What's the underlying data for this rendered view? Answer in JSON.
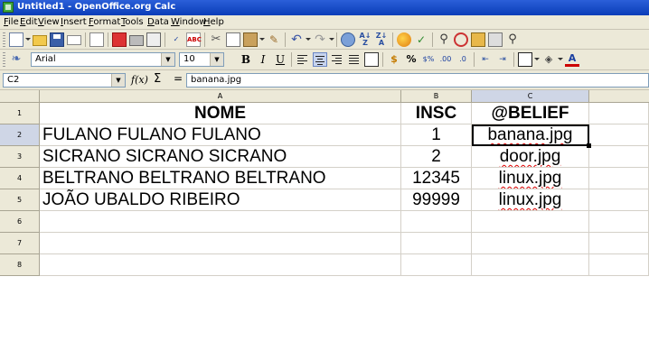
{
  "window": {
    "title": "Untitled1 - OpenOffice.org Calc"
  },
  "menu": [
    "File",
    "Edit",
    "View",
    "Insert",
    "Format",
    "Tools",
    "Data",
    "Window",
    "Help"
  ],
  "toolbar_format": {
    "font_name": "Arial",
    "font_size": "10"
  },
  "formula_bar": {
    "cell_ref": "C2",
    "fx": "f(x)",
    "sigma": "Σ",
    "equals": "=",
    "content": "banana.jpg"
  },
  "columns": [
    "A",
    "B",
    "C"
  ],
  "rows": [
    "1",
    "2",
    "3",
    "4",
    "5",
    "6",
    "7",
    "8"
  ],
  "sheet": {
    "header": {
      "a": "NOME",
      "b": "INSC",
      "c": "@BELIEF"
    },
    "data": [
      {
        "a": "FULANO FULANO FULANO",
        "b": "1",
        "c": "banana.jpg"
      },
      {
        "a": "SICRANO SICRANO SICRANO",
        "b": "2",
        "c": "door.jpg"
      },
      {
        "a": "BELTRANO BELTRANO BELTRANO",
        "b": "12345",
        "c": "linux.jpg"
      },
      {
        "a": "JOÃO UBALDO RIBEIRO",
        "b": "99999",
        "c": "linux.jpg"
      }
    ]
  },
  "selection": {
    "cell": "C2"
  },
  "colors": {
    "titlebar": "#0a3db8",
    "selection_header": "#cfd6e6",
    "spell_underline": "#d00000"
  }
}
